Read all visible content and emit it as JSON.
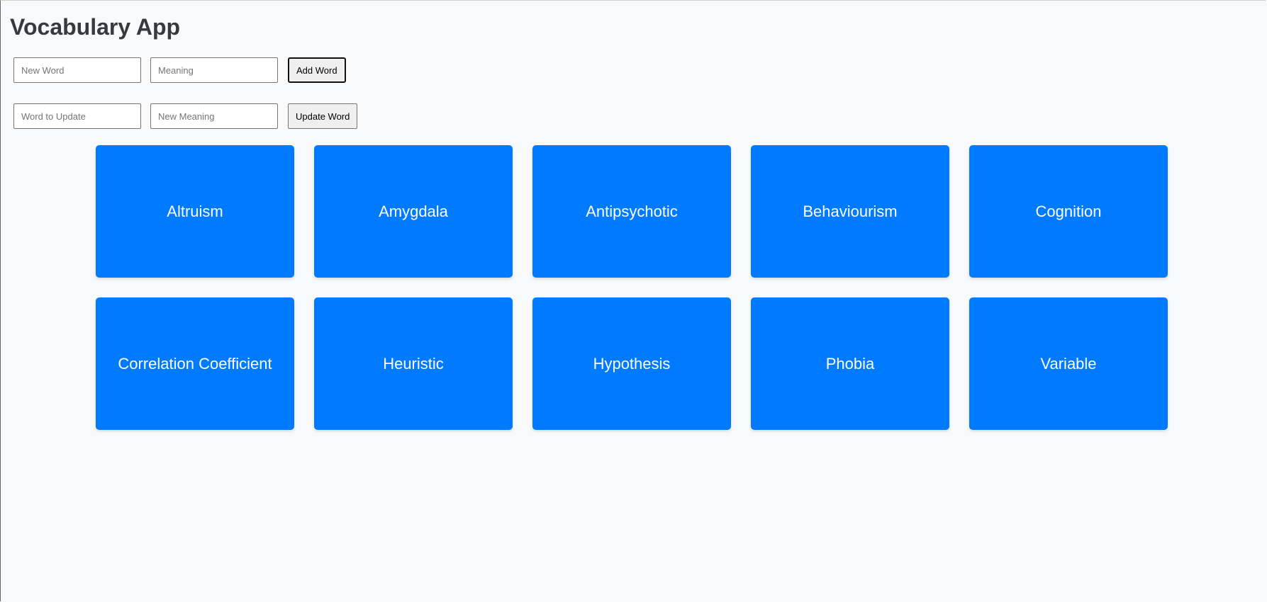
{
  "app": {
    "title": "Vocabulary App"
  },
  "add_form": {
    "word_placeholder": "New Word",
    "word_value": "",
    "meaning_placeholder": "Meaning",
    "meaning_value": "",
    "button_label": "Add Word"
  },
  "update_form": {
    "word_placeholder": "Word to Update",
    "word_value": "",
    "meaning_placeholder": "New Meaning",
    "meaning_value": "",
    "button_label": "Update Word"
  },
  "cards": [
    {
      "word": "Altruism"
    },
    {
      "word": "Amygdala"
    },
    {
      "word": "Antipsychotic"
    },
    {
      "word": "Behaviourism"
    },
    {
      "word": "Cognition"
    },
    {
      "word": "Correlation Coefficient"
    },
    {
      "word": "Heuristic"
    },
    {
      "word": "Hypothesis"
    },
    {
      "word": "Phobia"
    },
    {
      "word": "Variable"
    }
  ],
  "colors": {
    "background": "#f8f9fa",
    "card": "#007bff",
    "card_text": "#ffffff",
    "title": "#343a40"
  }
}
